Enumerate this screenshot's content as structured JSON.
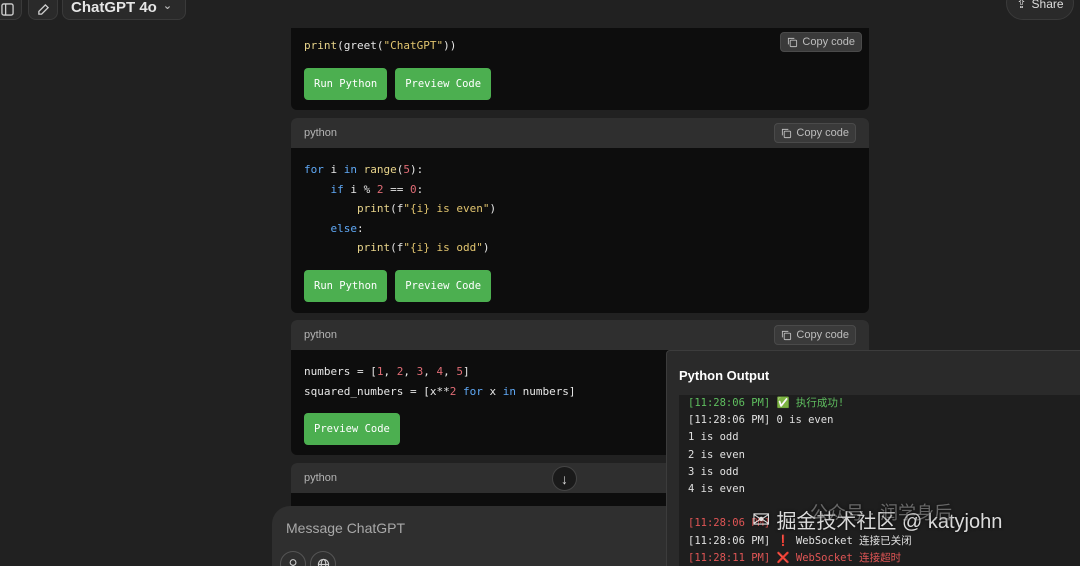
{
  "header": {
    "model_name": "ChatGPT 4o",
    "share_label": "Share"
  },
  "blocks": [
    {
      "code_lines_raw": "print(greet(\"ChatGPT\"))",
      "copy_label": "Copy code",
      "buttons": [
        "Run Python",
        "Preview Code"
      ]
    },
    {
      "language": "python",
      "copy_label": "Copy code",
      "buttons": [
        "Run Python",
        "Preview Code"
      ]
    },
    {
      "language": "python",
      "copy_label": "Copy code",
      "buttons": [
        "Preview Code"
      ]
    },
    {
      "language": "python"
    }
  ],
  "composer": {
    "placeholder": "Message ChatGPT"
  },
  "output_panel": {
    "title": "Python Output",
    "lines": [
      {
        "text": "[11:28:06 PM] ✅ 执行成功!",
        "kind": "green"
      },
      {
        "text": "[11:28:06 PM] 0 is even",
        "kind": "normal"
      },
      {
        "text": "1 is odd",
        "kind": "normal"
      },
      {
        "text": "2 is even",
        "kind": "normal"
      },
      {
        "text": "3 is odd",
        "kind": "normal"
      },
      {
        "text": "4 is even",
        "kind": "normal"
      },
      {
        "text": "",
        "kind": "normal"
      },
      {
        "text": "[11:28:06 PM]",
        "kind": "red"
      },
      {
        "text": "[11:28:06 PM] ❗ WebSocket 连接已关闭",
        "kind": "normal"
      },
      {
        "text": "[11:28:11 PM] ❌ WebSocket 连接超时",
        "kind": "red"
      }
    ]
  },
  "watermark": {
    "text": "掘金技术社区 @ katyjohn",
    "sub": "公众号 · 润学身后"
  },
  "colors": {
    "background": "#212121",
    "code_bg": "#0d0d0d",
    "button_green": "#4caf50",
    "keyword": "#5fa8f5",
    "string": "#e2c56f",
    "number": "#e06c75"
  }
}
